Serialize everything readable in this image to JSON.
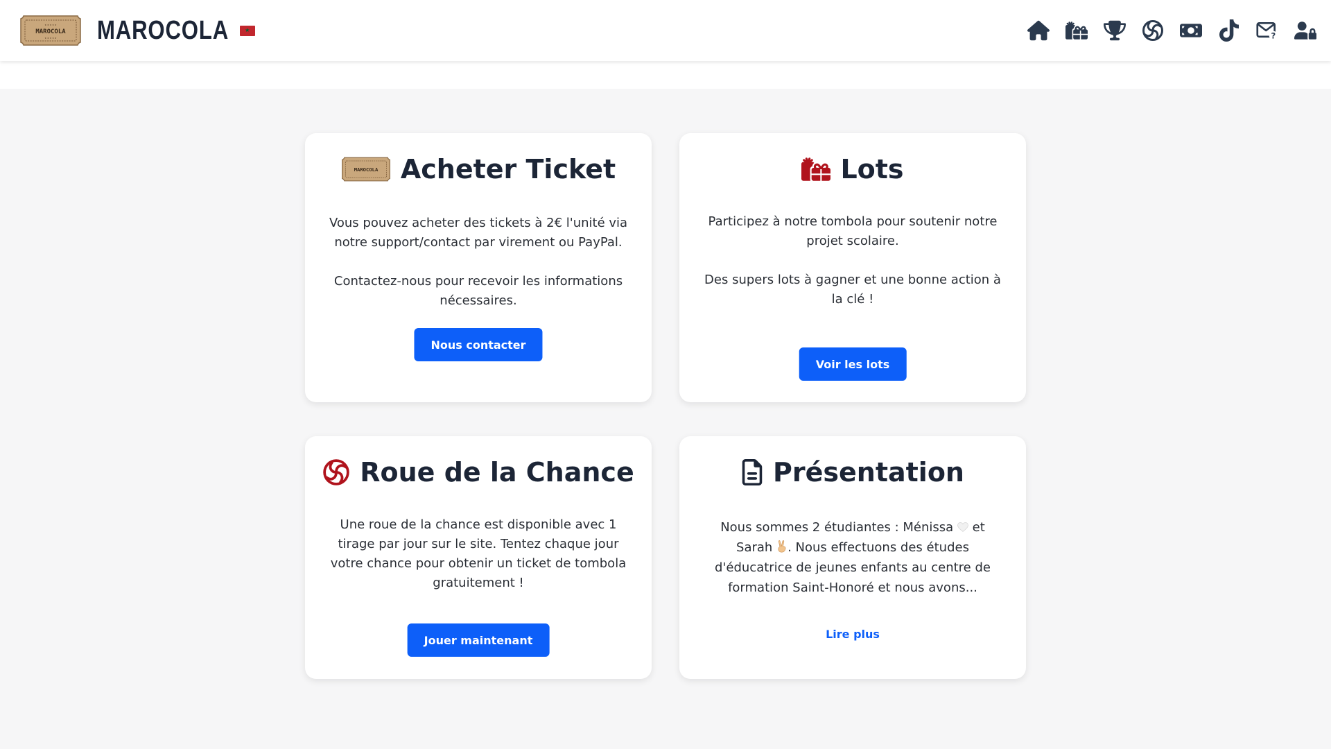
{
  "header": {
    "brand_name": "MAROCOLA",
    "logo_text": "MAROCOLA",
    "flag": "morocco-flag",
    "nav": [
      {
        "name": "home",
        "icon": "home-icon"
      },
      {
        "name": "lots",
        "icon": "gifts-icon"
      },
      {
        "name": "winners",
        "icon": "trophy-icon"
      },
      {
        "name": "wheel",
        "icon": "wheel-icon"
      },
      {
        "name": "payment",
        "icon": "money-icon"
      },
      {
        "name": "tiktok",
        "icon": "tiktok-icon"
      },
      {
        "name": "contact",
        "icon": "mail-question-icon"
      },
      {
        "name": "account",
        "icon": "user-lock-icon"
      }
    ]
  },
  "cards": {
    "ticket": {
      "title": "Acheter Ticket",
      "icon": "ticket-icon",
      "text1": "Vous pouvez acheter des tickets à 2€ l'unité via notre support/contact par virement ou PayPal.",
      "text2": "Contactez-nous pour recevoir les informations nécessaires.",
      "button": "Nous contacter"
    },
    "lots": {
      "title": "Lots",
      "icon": "gifts-icon",
      "text1": "Participez à notre tombola pour soutenir notre projet scolaire.",
      "text2": "Des supers lots à gagner et une bonne action à la clé !",
      "button": "Voir les lots"
    },
    "wheel": {
      "title": "Roue de la Chance",
      "icon": "wheel-icon",
      "text1": "Une roue de la chance est disponible avec 1 tirage par jour sur le site. Tentez chaque jour votre chance pour obtenir un ticket de tombola gratuitement !",
      "button": "Jouer maintenant"
    },
    "presentation": {
      "title": "Présentation",
      "icon": "document-icon",
      "text_a": "Nous sommes 2 étudiantes : Ménissa",
      "text_b": "et Sarah",
      "text_c": ". Nous effectuons des études d'éducatrice de jeunes enfants au centre de formation Saint-Honoré et nous avons...",
      "link": "Lire plus"
    }
  },
  "colors": {
    "accent": "#0d5ff9",
    "icon_red": "#b0131c",
    "title_dark": "#1c2536",
    "background": "#f6f6f7"
  }
}
